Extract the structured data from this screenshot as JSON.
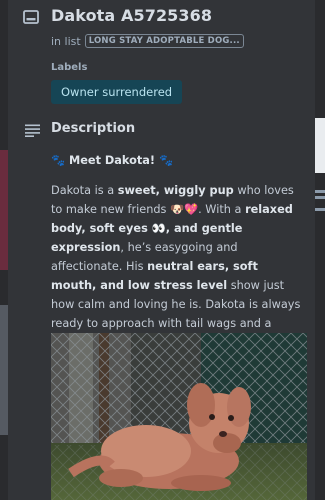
{
  "card": {
    "title": "Dakota A5725368",
    "in_list_prefix": "in list",
    "list_name": "LONG STAY ADOPTABLE DOG...",
    "labels_heading": "Labels",
    "label": "Owner surrendered",
    "label_color": "#164555",
    "description_heading": "Description"
  },
  "description": {
    "heading": "🐾 Meet Dakota! 🐾",
    "p1": [
      "Dakota is a ",
      "sweet, wiggly pup",
      " who loves to make new friends 🐶💖. With a ",
      "relaxed body, soft eyes 👀, and gentle expression",
      ", he’s easygoing and affectionate. His ",
      "neutral ears, soft mouth, and low stress level",
      " show just how calm and loving he is. Dakota is always ready to approach with tail wags and a happy heart 🐾❤️."
    ]
  },
  "icons": {
    "title": "card-icon",
    "description": "description-lines-icon"
  },
  "colors": {
    "card_bg": "#323438",
    "accent_chip_text": "#b9e3ef"
  }
}
